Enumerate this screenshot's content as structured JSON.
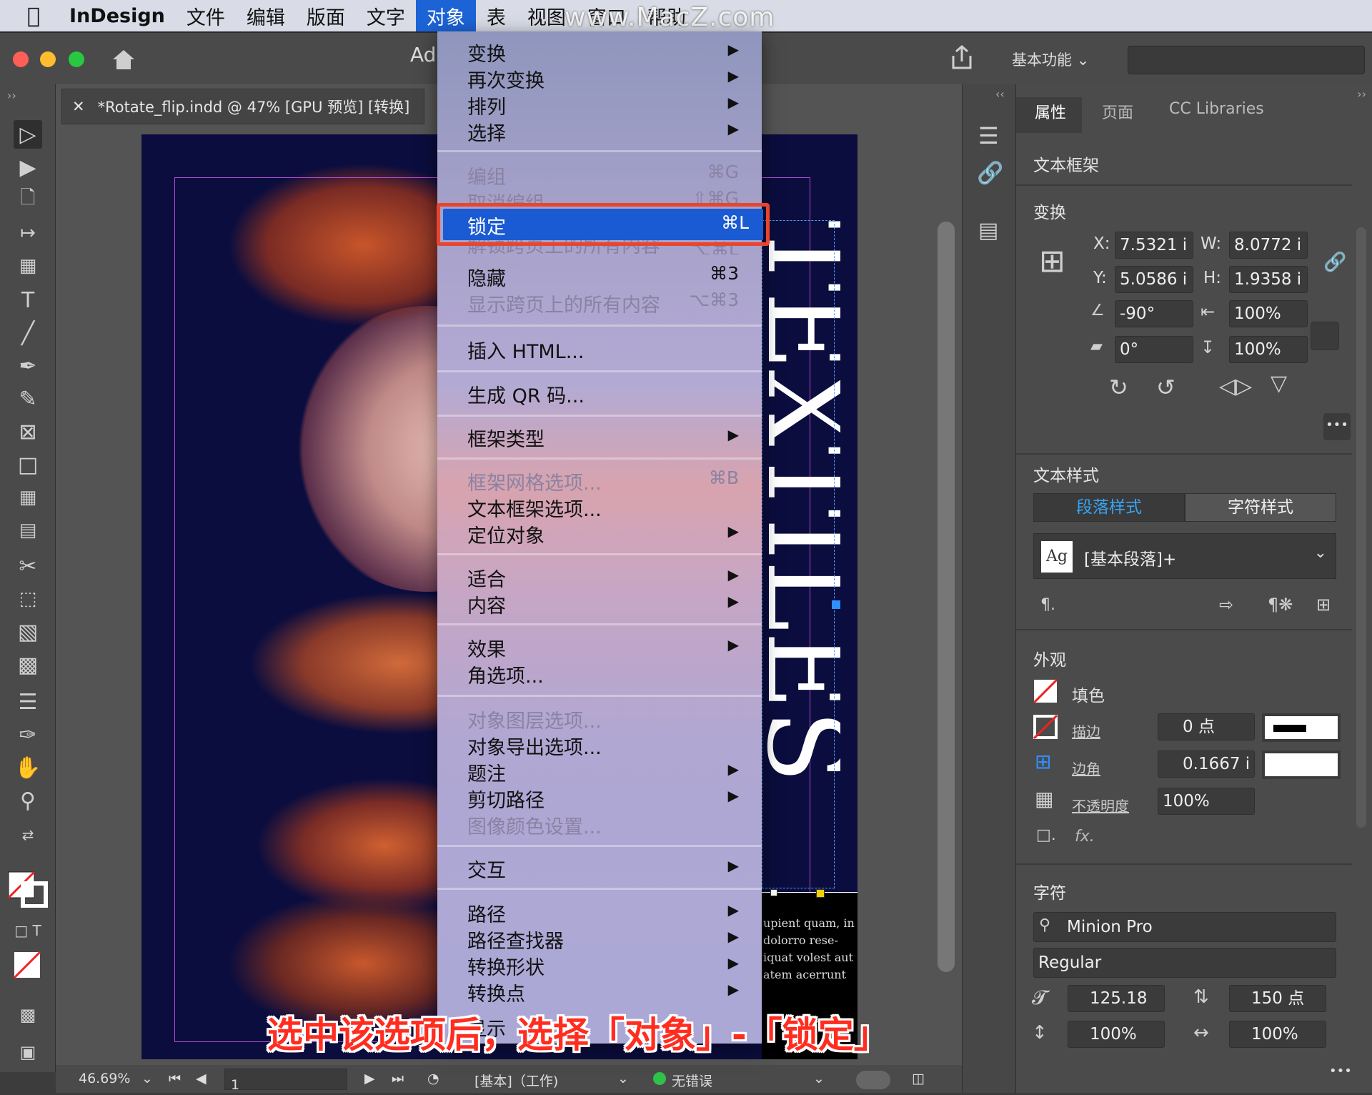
{
  "menubar": {
    "app": "InDesign",
    "items": [
      "文件",
      "编辑",
      "版面",
      "文字",
      "对象",
      "表",
      "视图",
      "窗口",
      "帮助"
    ],
    "active": "对象"
  },
  "watermark": "www.MacZ.com",
  "appbar": {
    "title_partial": "Ado",
    "workspace": "基本功能"
  },
  "document": {
    "tab": "*Rotate_flip.indd @ 47% [GPU 预览] [转换]",
    "body_text": [
      "upient quam, in",
      "dolorro rese-",
      "iquat volest aut",
      "atem acerrunt"
    ]
  },
  "status": {
    "zoom": "46.69%",
    "page": "1",
    "master": "[基本]（工作)",
    "errors": "无错误"
  },
  "menu": {
    "group1": [
      {
        "label": "变换",
        "submenu": true
      },
      {
        "label": "再次变换",
        "submenu": true
      },
      {
        "label": "排列",
        "submenu": true
      },
      {
        "label": "选择",
        "submenu": true
      }
    ],
    "group2": [
      {
        "label": "编组",
        "shortcut": "⌘G",
        "disabled": true
      },
      {
        "label": "取消编组",
        "shortcut": "⇧⌘G",
        "disabled": true
      }
    ],
    "lock": {
      "label": "锁定",
      "shortcut": "⌘L"
    },
    "group3": [
      {
        "label": "解锁跨页上的所有内容",
        "shortcut": "⌥⌘L",
        "disabled": true
      },
      {
        "label": "隐藏",
        "shortcut": "⌘3"
      },
      {
        "label": "显示跨页上的所有内容",
        "shortcut": "⌥⌘3",
        "disabled": true
      }
    ],
    "insert_html": "插入 HTML...",
    "qr": "生成 QR 码...",
    "frame_type": "框架类型",
    "group4": [
      {
        "label": "框架网格选项...",
        "shortcut": "⌘B",
        "disabled": true
      },
      {
        "label": "文本框架选项..."
      },
      {
        "label": "定位对象",
        "submenu": true
      }
    ],
    "group5": [
      {
        "label": "适合",
        "submenu": true
      },
      {
        "label": "内容",
        "submenu": true
      }
    ],
    "group6": [
      {
        "label": "效果",
        "submenu": true
      },
      {
        "label": "角选项..."
      }
    ],
    "group7": [
      {
        "label": "对象图层选项...",
        "disabled": true
      },
      {
        "label": "对象导出选项..."
      },
      {
        "label": "题注",
        "submenu": true
      },
      {
        "label": "剪切路径",
        "submenu": true
      },
      {
        "label": "图像颜色设置...",
        "disabled": true
      }
    ],
    "interactive": "交互",
    "group8": [
      {
        "label": "路径",
        "submenu": true
      },
      {
        "label": "路径查找器",
        "submenu": true
      },
      {
        "label": "转换形状",
        "submenu": true
      },
      {
        "label": "转换点",
        "submenu": true
      }
    ],
    "partial": "显示"
  },
  "props": {
    "tabs": [
      "属性",
      "页面",
      "CC Libraries"
    ],
    "type": "文本框架",
    "transform": {
      "title": "变换",
      "x_label": "X:",
      "x": "7.5321 i",
      "w_label": "W:",
      "w": "8.0772 i",
      "y_label": "Y:",
      "y": "5.0586 i",
      "h_label": "H:",
      "h": "1.9358 i",
      "rot": "-90°",
      "sx": "100%",
      "shear": "0°",
      "sy": "100%"
    },
    "textstyle": {
      "title": "文本样式",
      "para_tab": "段落样式",
      "char_tab": "字符样式",
      "style": "[基本段落]+",
      "ag": "Ag"
    },
    "appearance": {
      "title": "外观",
      "fill": "填色",
      "stroke": "描边",
      "stroke_val": "0 点",
      "corner": "边角",
      "corner_val": "0.1667 i",
      "opacity": "不透明度",
      "opacity_val": "100%",
      "fx": "fx."
    },
    "char": {
      "title": "字符",
      "font": "Minion Pro",
      "style": "Regular",
      "size": "125.18",
      "leading": "150 点",
      "vscale": "100%",
      "hscale": "100%"
    }
  },
  "caption": "选中该选项后，选择「对象」-「锁定」",
  "colors": {
    "menu_highlight": "#1a5ad2",
    "callout": "#e8452f",
    "caption": "#ff2d20",
    "accent_tab": "#37a5f5"
  }
}
